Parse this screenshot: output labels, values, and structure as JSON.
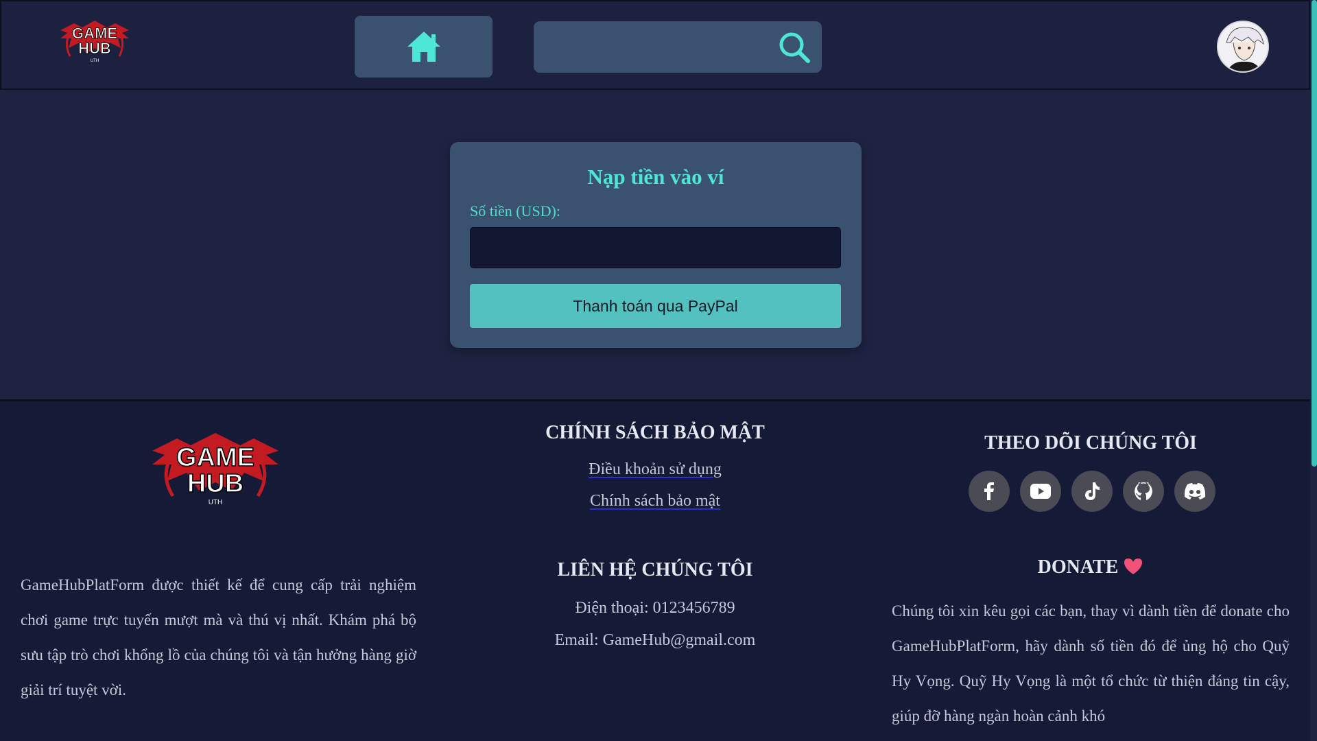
{
  "header": {
    "logo_text_line1": "GAME",
    "logo_text_line2": "HUB",
    "logo_text_sub": "UTH",
    "home_icon": "home-icon",
    "search": {
      "value": "",
      "placeholder": "",
      "icon": "search-icon"
    }
  },
  "deposit": {
    "title": "Nạp tiền vào ví",
    "amount_label": "Số tiền (USD):",
    "amount_value": "",
    "pay_button": "Thanh toán qua PayPal"
  },
  "footer": {
    "about": "GameHubPlatForm được thiết kế để cung cấp trải nghiệm chơi game trực tuyến mượt mà và thú vị nhất. Khám phá bộ sưu tập trò chơi khổng lồ của chúng tôi và tận hưởng hàng giờ giải trí tuyệt vời.",
    "policy_heading": "CHÍNH SÁCH BẢO MẬT",
    "terms_link": "Điều khoản sử dụng",
    "privacy_link": "Chính sách bảo mật",
    "contact_heading": "LIÊN HỆ CHÚNG TÔI",
    "phone": "Điện thoại: 0123456789",
    "email": "Email: GameHub@gmail.com",
    "follow_heading": "THEO DÕI CHÚNG TÔI",
    "socials": [
      "facebook-icon",
      "youtube-icon",
      "tiktok-icon",
      "github-icon",
      "discord-icon"
    ],
    "donate_heading": "DONATE",
    "donate_text": "Chúng tôi xin kêu gọi các bạn, thay vì dành tiền để donate cho GameHubPlatForm, hãy dành số tiền đó để ủng hộ cho Quỹ Hy Vọng. Quỹ Hy Vọng là một tổ chức từ thiện đáng tin cậy, giúp đỡ hàng ngàn hoàn cảnh khó"
  },
  "colors": {
    "accent": "#4ee6d6",
    "button": "#53c1c0",
    "panel": "#3a516f",
    "background": "#1e2342",
    "footer": "#151a37",
    "logo_red": "#d0202a"
  }
}
